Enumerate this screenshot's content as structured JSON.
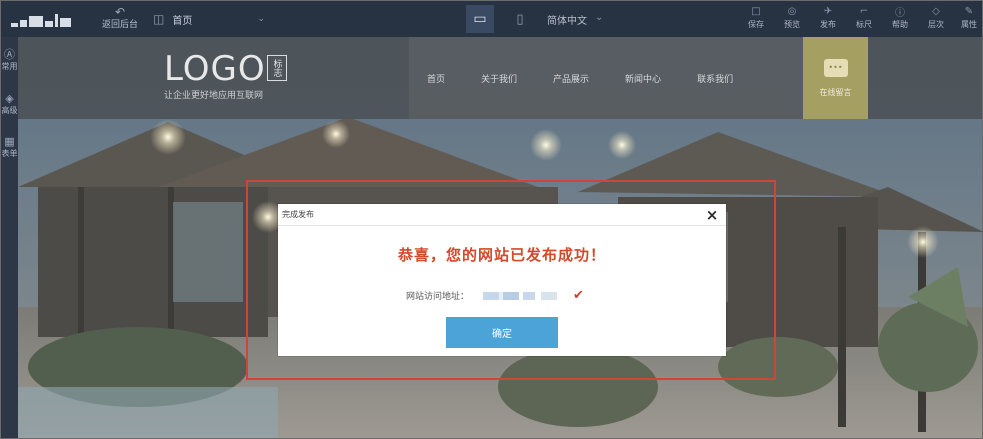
{
  "toolbar": {
    "back_label": "返回后台",
    "page_name": "首页",
    "language": "简体中文",
    "tools": [
      {
        "name": "save",
        "label": "保存"
      },
      {
        "name": "preview",
        "label": "预览"
      },
      {
        "name": "publish",
        "label": "发布"
      },
      {
        "name": "ruler",
        "label": "标尺"
      },
      {
        "name": "help",
        "label": "帮助"
      },
      {
        "name": "layers",
        "label": "层次"
      },
      {
        "name": "properties",
        "label": "属性"
      }
    ]
  },
  "sidebar": {
    "items": [
      {
        "name": "common",
        "label": "常用"
      },
      {
        "name": "advanced",
        "label": "高级"
      },
      {
        "name": "forms",
        "label": "表单"
      }
    ]
  },
  "site": {
    "logo_text": "LOGO",
    "logo_mark": "标志",
    "slogan": "让企业更好地应用互联网",
    "nav": [
      "首页",
      "关于我们",
      "产品展示",
      "新闻中心",
      "联系我们"
    ],
    "consult_label": "在线留言",
    "consult_icon": "•••"
  },
  "dialog": {
    "header": "完成发布",
    "close": "×",
    "message": "恭喜，您的网站已发布成功！",
    "url_label": "网站访问地址：",
    "confirm_label": "确定"
  },
  "icons": {
    "back": "↶",
    "page": "◫",
    "chevron": "⌄",
    "desktop": "▭",
    "mobile": "▯",
    "checkmark": "✔",
    "common": "Ⓐ",
    "advanced": "◈",
    "forms": "▦",
    "save": "□",
    "preview": "◎",
    "publish": "✈",
    "ruler": "⌐",
    "help": "ⓘ",
    "layers": "◇",
    "properties": "✎"
  },
  "colors": {
    "toolbar_bg": "#273243",
    "highlight_border": "#d0453a",
    "dialog_title": "#d34a2a",
    "confirm_button": "#4ba3d8",
    "check_color": "#c94232"
  }
}
